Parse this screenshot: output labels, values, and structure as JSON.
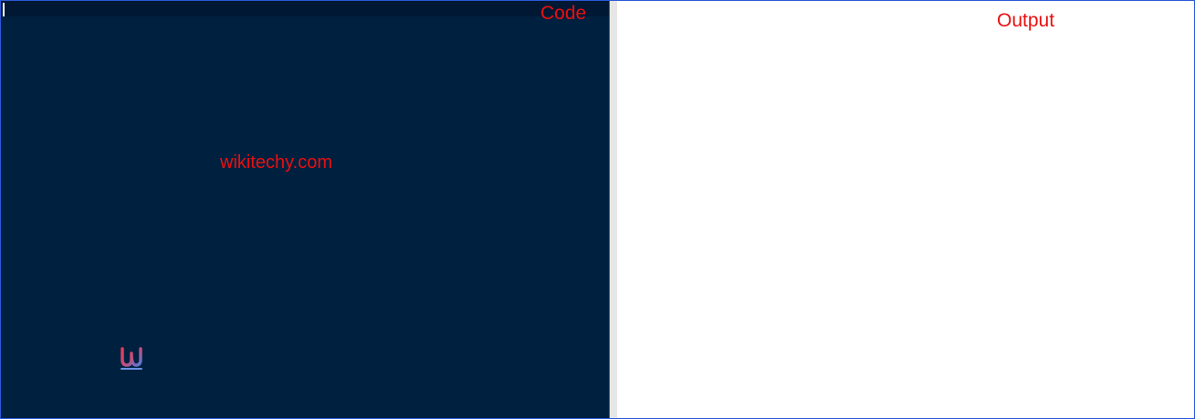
{
  "code_pane": {
    "label": "Code",
    "watermark": "wikitechy.com",
    "logo_icon": "wikitechy-logo-icon",
    "background": "#00203f"
  },
  "output_pane": {
    "label": "Output",
    "background": "#ffffff"
  },
  "colors": {
    "label_red": "#e81010",
    "border_blue": "#2b59d9",
    "divider_gray": "#e6e6e6"
  }
}
